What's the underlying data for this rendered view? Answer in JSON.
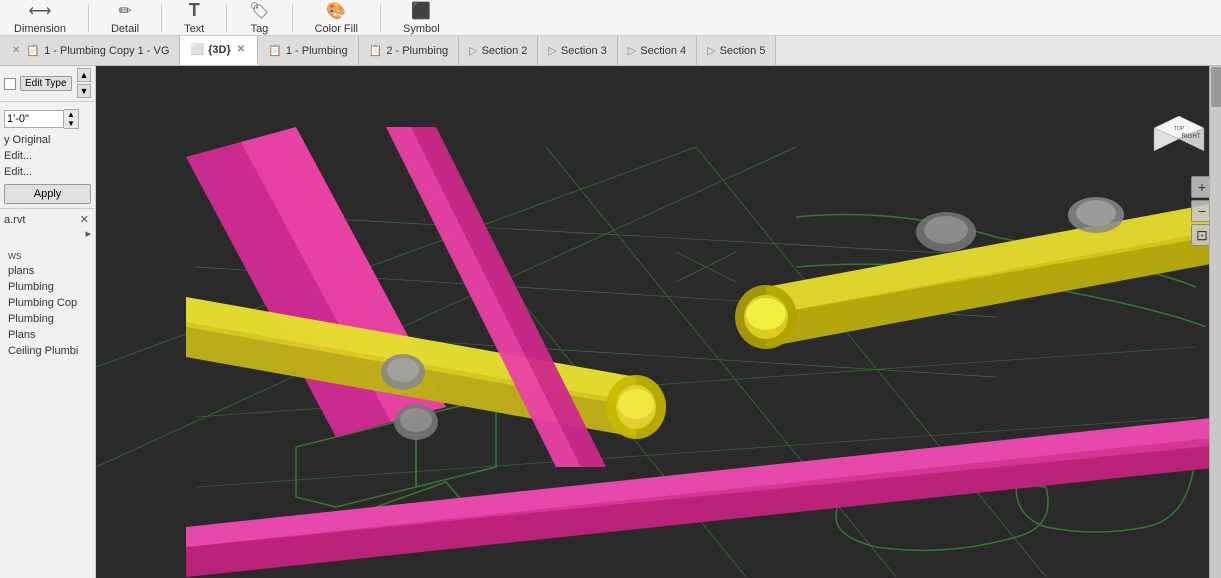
{
  "ribbon": {
    "items": [
      {
        "id": "dimension",
        "label": "Dimension",
        "icon": "⟷",
        "has_arrow": true
      },
      {
        "id": "detail",
        "label": "Detail",
        "icon": "✏"
      },
      {
        "id": "text",
        "label": "Text",
        "icon": "T",
        "has_arrow": true
      },
      {
        "id": "tag",
        "label": "Tag",
        "icon": "🏷",
        "has_arrow": true
      },
      {
        "id": "color_fill",
        "label": "Color Fill",
        "icon": "🎨"
      },
      {
        "id": "symbol",
        "label": "Symbol",
        "icon": "⬛"
      }
    ]
  },
  "tabs": [
    {
      "id": "plumbing_vg",
      "label": "1 - Plumbing Copy 1 - VG",
      "icon": "📋",
      "closeable": true,
      "active": false
    },
    {
      "id": "3d",
      "label": "{3D}",
      "icon": "⬜",
      "closeable": true,
      "active": true
    },
    {
      "id": "plumbing1",
      "label": "1 - Plumbing",
      "icon": "📋",
      "closeable": false,
      "active": false
    },
    {
      "id": "plumbing2",
      "label": "2 - Plumbing",
      "icon": "📋",
      "closeable": false,
      "active": false
    },
    {
      "id": "section2",
      "label": "Section 2",
      "icon": "▷",
      "closeable": false,
      "active": false
    },
    {
      "id": "section3",
      "label": "Section 3",
      "icon": "▷",
      "closeable": false,
      "active": false
    },
    {
      "id": "section4",
      "label": "Section 4",
      "icon": "▷",
      "closeable": false,
      "active": false
    },
    {
      "id": "section5",
      "label": "Section 5",
      "icon": "▷",
      "closeable": false,
      "active": false
    }
  ],
  "left_panel": {
    "edit_type": {
      "label": "Edit Type",
      "button_label": "Edit Type"
    },
    "value_input": "1'-0\"",
    "scroll_items": [
      {
        "label": "y Original"
      },
      {
        "label": "Edit..."
      },
      {
        "label": "Edit..."
      }
    ],
    "apply_button": "Apply",
    "file": {
      "name": "a.rvt",
      "close_icon": "✕"
    },
    "expand_icon": "▸",
    "nav_section": {
      "section_label": "ws",
      "items": [
        {
          "label": "plans"
        },
        {
          "label": "Plumbing"
        },
        {
          "label": "Plumbing Cop"
        },
        {
          "label": "Plumbing"
        },
        {
          "label": "Plans"
        },
        {
          "label": "Ceiling Plumbi"
        }
      ]
    }
  },
  "nav_cube": {
    "face": "RIGHT",
    "top_face": "TOP"
  },
  "viewport": {
    "background_color": "#1e1e1e"
  },
  "zoom_controls": [
    {
      "id": "zoom_in",
      "icon": "+"
    },
    {
      "id": "zoom_out",
      "icon": "−"
    },
    {
      "id": "zoom_fit",
      "icon": "⊡"
    }
  ]
}
